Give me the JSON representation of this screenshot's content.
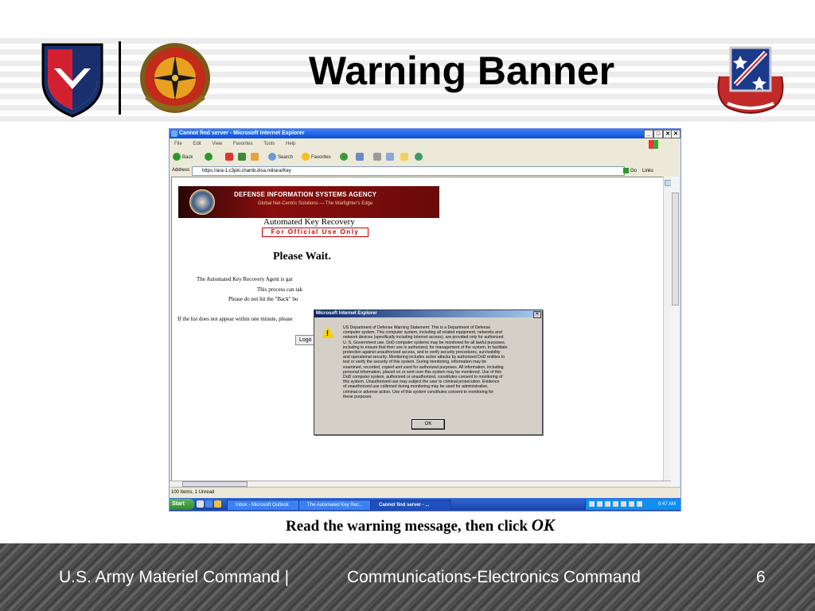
{
  "slide": {
    "title": "Warning Banner",
    "caption_text": "Read the warning message, then click ",
    "caption_emph": "OK",
    "footer_left": "U.S. Army Materiel Command  |",
    "footer_center": "Communications-Electronics Command",
    "page_number": "6"
  },
  "browser": {
    "window_title": "Cannot find server - Microsoft Internet Explorer",
    "menu": [
      "File",
      "Edit",
      "View",
      "Favorites",
      "Tools",
      "Help"
    ],
    "toolbar": {
      "back": "Back",
      "search": "Search",
      "favorites": "Favorites"
    },
    "address_label": "Address",
    "address_url": "https://ara-1.c3pki.chamb.disa.mil/ara/Key",
    "go_label": "Go",
    "links_label": "Links"
  },
  "page": {
    "agency_name": "DEFENSE INFORMATION SYSTEMS AGENCY",
    "agency_tagline": "Global Net-Centric Solutions — The Warfighter's Edge",
    "app_title": "Automated Key Recovery",
    "fouo": "For Official Use Only",
    "please_wait": "Please Wait.",
    "line1": "The Automated Key Recovery Agent is gat",
    "line2": "This process can tak",
    "line3": "Please do not hit the \"Back\" bu",
    "line4": "If the list does not appear within one minute, please",
    "logout": "Logo"
  },
  "dialog": {
    "title": "Microsoft Internet Explorer",
    "lines": [
      "US Department of Defense Warning Statement:  This is a Department of Defense",
      "computer system. This computer system, including all related equipment, networks and",
      "network devices (specifically including Internet access), are provided only for authorized",
      "U. S. Government use. DoD computer systems may be monitored for all lawful purposes,",
      "including to ensure that their use is authorized, for management of the system, to facilitate",
      "protection against unauthorized access, and to verify security procedures, survivability",
      "and operational security. Monitoring includes active attacks by authorized DoD entities to",
      "test or verify the security of this system. During monitoring, information may be",
      "examined, recorded, copied and used for authorized purposes. All information, including",
      "personal information, placed on or sent over this system may be monitored. Use of this",
      "DoD computer system, authorized or unauthorized, constitutes consent to monitoring of",
      "this system. Unauthorized use may subject the user to criminal prosecution. Evidence",
      "of unauthorized use collected during monitoring may be used for administrative,",
      "criminal or adverse action. Use of this system constitutes consent to monitoring for",
      "these purposes."
    ],
    "ok_label": "OK"
  },
  "status": {
    "text": "100 Items, 1 Unread"
  },
  "taskbar": {
    "start": "Start",
    "items": [
      "Inbox - Microsoft Outlook",
      "The Automated Key Rec...",
      "Cannot find server - ..."
    ],
    "clock": "9:47 AM"
  }
}
